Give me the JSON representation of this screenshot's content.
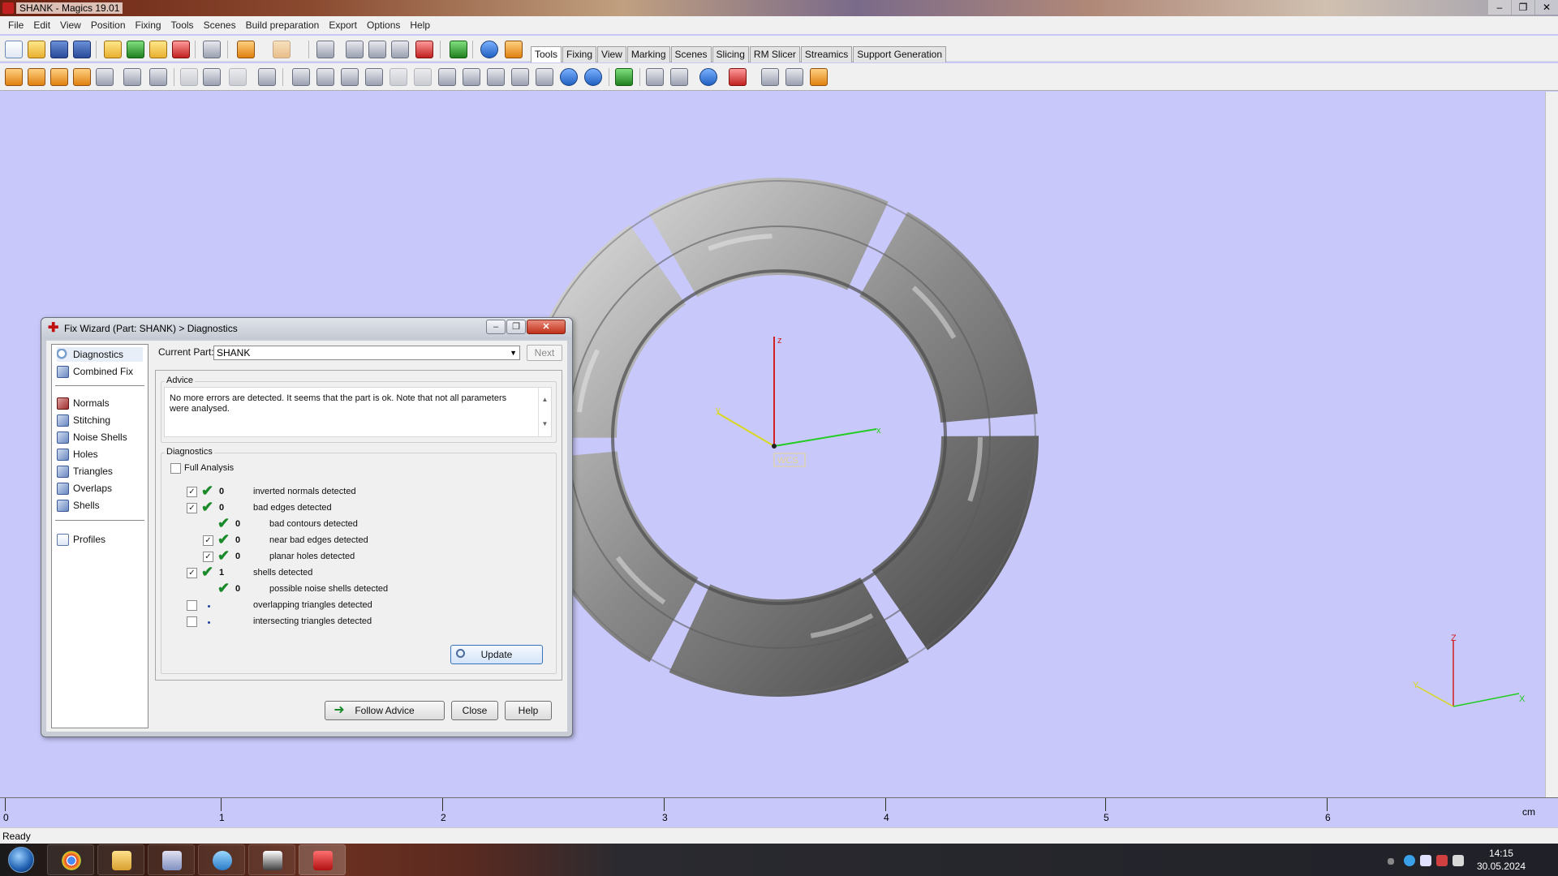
{
  "window": {
    "title": "SHANK - Magics 19.01",
    "controls": [
      "–",
      "❐",
      "✕"
    ]
  },
  "menubar": [
    "File",
    "Edit",
    "View",
    "Position",
    "Fixing",
    "Tools",
    "Scenes",
    "Build preparation",
    "Export",
    "Options",
    "Help"
  ],
  "tabs": [
    {
      "label": "Tools",
      "active": true
    },
    {
      "label": "Fixing"
    },
    {
      "label": "View"
    },
    {
      "label": "Marking"
    },
    {
      "label": "Scenes"
    },
    {
      "label": "Slicing"
    },
    {
      "label": "RM Slicer"
    },
    {
      "label": "Streamics"
    },
    {
      "label": "Support Generation"
    }
  ],
  "viewport": {
    "axes": {
      "z": "z",
      "x": "x",
      "y": "y",
      "wcs": "WCS"
    },
    "corner_axes": {
      "z": "Z",
      "x": "X",
      "y": "Y"
    },
    "colors": {
      "background": "#c8c8fa",
      "x_axis": "#22cc22",
      "y_axis": "#d8d820",
      "z_axis": "#d02020",
      "part": "#8a8a8a"
    }
  },
  "ruler": {
    "labels": [
      "0",
      "1",
      "2",
      "3",
      "4",
      "5",
      "6"
    ],
    "unit": "cm"
  },
  "status": {
    "text": "Ready"
  },
  "taskbar": {
    "apps": [
      "chrome-icon",
      "explorer-icon",
      "paint-icon",
      "v8-icon",
      "tool-icon",
      "magics-icon"
    ],
    "clock_time": "14:15",
    "clock_date": "30.05.2024"
  },
  "dialog": {
    "title": "Fix Wizard (Part: SHANK) > Diagnostics",
    "nav": {
      "top": [
        {
          "label": "Diagnostics",
          "icon": "magnifier-icon"
        },
        {
          "label": "Combined Fix",
          "icon": "cube-icon"
        }
      ],
      "mid": [
        {
          "label": "Normals",
          "icon": "cube-red-icon"
        },
        {
          "label": "Stitching",
          "icon": "cube-icon"
        },
        {
          "label": "Noise Shells",
          "icon": "cube-icon"
        },
        {
          "label": "Holes",
          "icon": "cube-icon"
        },
        {
          "label": "Triangles",
          "icon": "cube-icon"
        },
        {
          "label": "Overlaps",
          "icon": "cube-icon"
        },
        {
          "label": "Shells",
          "icon": "cube-icon"
        }
      ],
      "bottom": [
        {
          "label": "Profiles",
          "icon": "doc-icon"
        }
      ]
    },
    "current_part_label": "Current Part:",
    "current_part_value": "SHANK",
    "next_label": "Next",
    "advice_title": "Advice",
    "advice_text": "No more errors are detected. It seems that the part is ok. Note that not all parameters were analysed.",
    "diagnostics_title": "Diagnostics",
    "full_analysis_label": "Full Analysis",
    "rows": [
      {
        "count": "0",
        "label": "inverted normals detected",
        "checked": true,
        "ok": true
      },
      {
        "count": "0",
        "label": "bad edges detected",
        "checked": true,
        "ok": true
      },
      {
        "count": "0",
        "label": "bad contours detected",
        "ok": true
      },
      {
        "count": "0",
        "label": "near bad edges detected",
        "checked": true,
        "ok": true
      },
      {
        "count": "0",
        "label": "planar holes detected",
        "checked": true,
        "ok": true
      },
      {
        "count": "1",
        "label": "shells detected",
        "checked": true,
        "ok": true
      },
      {
        "count": "0",
        "label": "possible noise shells detected",
        "ok": true
      },
      {
        "count": "",
        "label": "overlapping triangles detected",
        "checked": false
      },
      {
        "count": "",
        "label": "intersecting triangles detected",
        "checked": false
      }
    ],
    "update_label": "Update",
    "follow_advice_label": "Follow Advice",
    "close_label": "Close",
    "help_label": "Help"
  }
}
